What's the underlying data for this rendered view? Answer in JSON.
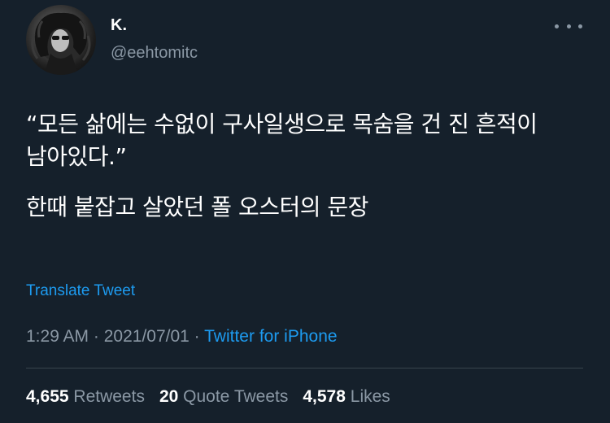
{
  "user": {
    "display_name": "K.",
    "handle": "@eehtomitc"
  },
  "more_icon": "more-horizontal-icon",
  "tweet": {
    "line1": "“모든 삶에는 수없이 구사일생으로 목숨을 건 진 흔적이 남아있다.”",
    "line2": "한때 붙잡고 살았던 폴 오스터의 문장"
  },
  "translate_label": "Translate Tweet",
  "meta": {
    "time": "1:29 AM",
    "sep1": " · ",
    "date": "2021/07/01",
    "sep2": " · ",
    "source": "Twitter for iPhone"
  },
  "stats": {
    "retweets_count": "4,655",
    "retweets_label": "Retweets",
    "quotes_count": "20",
    "quotes_label": "Quote Tweets",
    "likes_count": "4,578",
    "likes_label": "Likes"
  },
  "colors": {
    "background": "#15202b",
    "accent": "#1d9bf0",
    "secondary_text": "#8b98a5",
    "divider": "#38444d"
  }
}
